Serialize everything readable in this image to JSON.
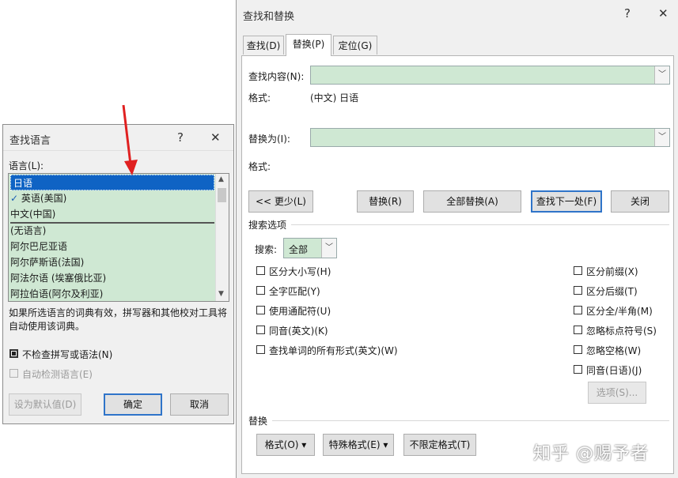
{
  "main_dialog": {
    "title": "查找和替换",
    "help": "?",
    "close": "✕",
    "tabs": [
      "查找(D)",
      "替换(P)",
      "定位(G)"
    ],
    "tab_keys": [
      "D",
      "P",
      "G"
    ],
    "find_label": "查找内容(N):",
    "find_value": "",
    "find_format_label": "格式:",
    "find_format_value": "(中文) 日语",
    "replace_label": "替换为(I):",
    "replace_value": "",
    "replace_format_label": "格式:",
    "buttons": {
      "less": "<< 更少(L)",
      "replace": "替换(R)",
      "replace_all": "全部替换(A)",
      "find_next": "查找下一处(F)",
      "close": "关闭"
    },
    "search_options_title": "搜索选项",
    "search_label": "搜索:",
    "search_value": "全部",
    "left_options": [
      "区分大小写(H)",
      "全字匹配(Y)",
      "使用通配符(U)",
      "同音(英文)(K)",
      "查找单词的所有形式(英文)(W)"
    ],
    "right_options": [
      "区分前缀(X)",
      "区分后缀(T)",
      "区分全/半角(M)",
      "忽略标点符号(S)",
      "忽略空格(W)",
      "同音(日语)(J)"
    ],
    "options_button": "选项(S)...",
    "replace_section_title": "替换",
    "bottom_buttons": [
      "格式(O) ▾",
      "特殊格式(E) ▾",
      "不限定格式(T)"
    ]
  },
  "lang_dialog": {
    "title": "查找语言",
    "help": "?",
    "close": "✕",
    "list_label": "语言(L):",
    "items": [
      "日语",
      "英语(美国)",
      "中文(中国)",
      "(无语言)",
      "阿尔巴尼亚语",
      "阿尔萨斯语(法国)",
      "阿法尔语 (埃塞俄比亚)",
      "阿拉伯语(阿尔及利亚)"
    ],
    "description": "如果所选语言的词典有效，拼写器和其他校对工具将自动使用该词典。",
    "no_check_label": "不检查拼写或语法(N)",
    "auto_detect_label": "自动检测语言(E)",
    "default_button": "设为默认值(D)",
    "ok_button": "确定",
    "cancel_button": "取消"
  },
  "watermark": "知乎 @赐予者",
  "colors": {
    "accent": "#2f74c9",
    "field_green": "#cfe8d3",
    "selection": "#0f63c4",
    "arrow_red": "#e02020"
  }
}
